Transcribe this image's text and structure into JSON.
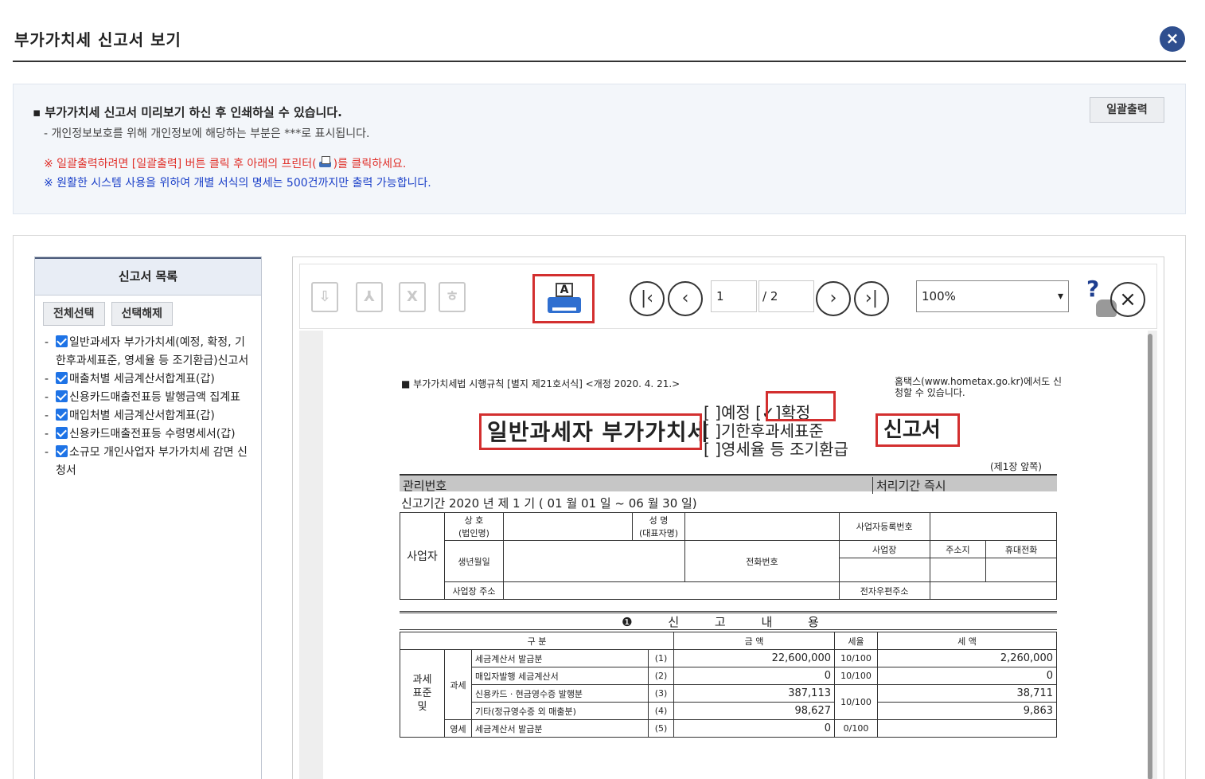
{
  "header": {
    "title": "부가가치세 신고서 보기",
    "close_icon": "close-icon"
  },
  "notice": {
    "line1": "부가가치세 신고서 미리보기 하신 후 인쇄하실 수 있습니다.",
    "line2": "- 개인정보보호를 위해 개인정보에 해당하는 부분은  ***로 표시됩니다.",
    "line3_before": "※ 일괄출력하려면 [일괄출력] 버튼 클릭 후 아래의 프린터(",
    "line3_after": ")를 클릭하세요.",
    "line4": "※ 원활한 시스템 사용을 위하여 개별 서식의 명세는 500건까지만 출력 가능합니다.",
    "print_all_label": "일괄출력",
    "colors": {
      "warning": "#e0302a",
      "info": "#1a3fc8"
    }
  },
  "sidebar": {
    "title": "신고서 목록",
    "select_all": "전체선택",
    "deselect_all": "선택해제",
    "items": [
      {
        "label": "일반과세자 부가가치세(예정, 확정, 기한후과세표준, 영세율 등 조기환급)신고서",
        "checked": true
      },
      {
        "label": "매출처별 세금계산서합계표(갑)",
        "checked": true
      },
      {
        "label": "신용카드매출전표등 발행금액 집계표",
        "checked": true
      },
      {
        "label": "매입처별 세금계산서합계표(갑)",
        "checked": true
      },
      {
        "label": "신용카드매출전표등 수령명세서(갑)",
        "checked": true
      },
      {
        "label": "소규모 개인사업자 부가가치세 감면 신청서",
        "checked": true
      }
    ]
  },
  "viewer": {
    "toolbar": {
      "page_current": "1",
      "page_total": "/ 2",
      "zoom": "100%",
      "icons": [
        "save-icon",
        "pdf-icon",
        "excel-icon",
        "hwp-icon",
        "printer-icon",
        "first-page-icon",
        "prev-page-icon",
        "next-page-icon",
        "last-page-icon",
        "help-icon",
        "close-icon"
      ]
    },
    "document": {
      "form_ref": "■ 부가가치세법 시행규칙 [별지 제21호서식] <개정 2020. 4. 21.>",
      "hometax_note": "홈택스(www.hometax.go.kr)에서도 신청할 수 있습니다.",
      "title_left": "일반과세자 부가가치세",
      "opt1_a": "[  ]예정",
      "opt1_b": "[✓]확정",
      "opt2": "[  ]기한후과세표준",
      "opt3": "[  ]영세율 등 조기환급",
      "title_right": "신고서",
      "page_side": "(제1장 앞쪽)",
      "mgmt_no": "관리번호",
      "proc_period": "처리기간 즉시",
      "period": "신고기간 2020 년 제  1   기 (  01  월    01  일 ~  06  월    30  일)",
      "biz": {
        "label": "사업자",
        "name": "상  호\n(법인명)",
        "rep": "성  명\n(대표자명)",
        "reg_no": "사업자등록번호",
        "birth": "생년월일",
        "phone": "전화번호",
        "office": "사업장",
        "home": "주소지",
        "mobile": "휴대전화",
        "addr": "사업장 주소",
        "email": "전자우편주소"
      },
      "section": "❶ 신 고 내 용",
      "cols": {
        "category": "구          분",
        "amount": "금          액",
        "rate": "세율",
        "tax": "세          액"
      },
      "left_labels": {
        "tax_base": "과세\n표준\n및",
        "taxable": "과세",
        "zero": "영세"
      },
      "rows": [
        {
          "desc": "세금계산서 발급분",
          "no": "(1)",
          "amount": "22,600,000",
          "rate": "10/100",
          "tax": "2,260,000"
        },
        {
          "desc": "매입자발행 세금계산서",
          "no": "(2)",
          "amount": "0",
          "rate": "10/100",
          "tax": "0"
        },
        {
          "desc": "신용카드ㆍ현금영수증 발행분",
          "no": "(3)",
          "amount": "387,113",
          "rate": "10/100",
          "tax": "38,711"
        },
        {
          "desc": "기타(정규영수증 외 매출분)",
          "no": "(4)",
          "amount": "98,627",
          "rate": "",
          "tax": "9,863"
        },
        {
          "desc": "세금계산서 발급분",
          "no": "(5)",
          "amount": "0",
          "rate": "0/100",
          "tax": ""
        }
      ]
    }
  }
}
